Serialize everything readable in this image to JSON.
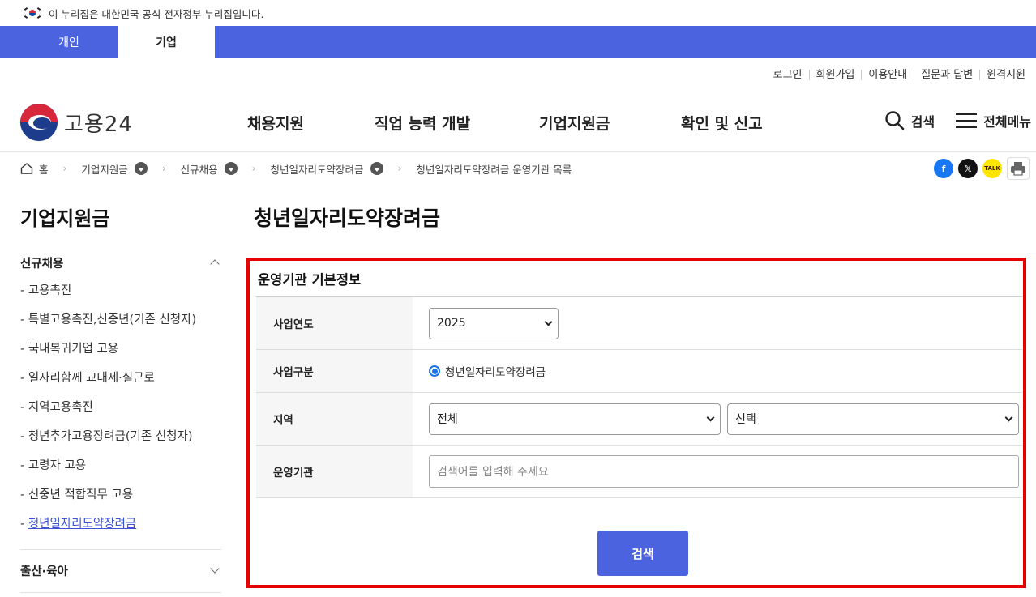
{
  "gov_banner": {
    "text": "이 누리집은 대한민국 공식 전자정부 누리집입니다."
  },
  "top_tabs": [
    {
      "label": "개인"
    },
    {
      "label": "기업"
    }
  ],
  "util_links": [
    "로그인",
    "회원가입",
    "이용안내",
    "질문과 답변",
    "원격지원"
  ],
  "logo": {
    "text": "고용24"
  },
  "gnb": [
    "채용지원",
    "직업 능력 개발",
    "기업지원금",
    "확인 및 신고"
  ],
  "header_actions": {
    "search": "검색",
    "menu": "전체메뉴"
  },
  "breadcrumb": [
    "홈",
    "기업지원금",
    "신규채용",
    "청년일자리도약장려금",
    "청년일자리도약장려금 운영기관 목록"
  ],
  "share": {
    "kakao": "TALK"
  },
  "sidebar": {
    "title": "기업지원금",
    "group1": {
      "label": "신규채용",
      "items": [
        "- 고용촉진",
        "- 특별고용촉진,신중년(기존 신청자)",
        "- 국내복귀기업 고용",
        "- 일자리함께 교대제·실근로",
        "- 지역고용촉진",
        "- 청년추가고용장려금(기존 신청자)",
        "- 고령자 고용",
        "- 신중년 적합직무 고용",
        "청년일자리도약장려금"
      ]
    },
    "group2": {
      "label": "출산·육아"
    }
  },
  "main": {
    "title": "청년일자리도약장려금",
    "form": {
      "title": "운영기관 기본정보",
      "year_label": "사업연도",
      "year_value": "2025",
      "type_label": "사업구분",
      "type_value": "청년일자리도약장려금",
      "region_label": "지역",
      "region_value": "전체",
      "subregion_value": "선택",
      "org_label": "운영기관",
      "org_placeholder": "검색어를 입력해 주세요",
      "search_button": "검색"
    }
  },
  "colors": {
    "brand": "#4c63e0",
    "highlight": "#e60000"
  }
}
